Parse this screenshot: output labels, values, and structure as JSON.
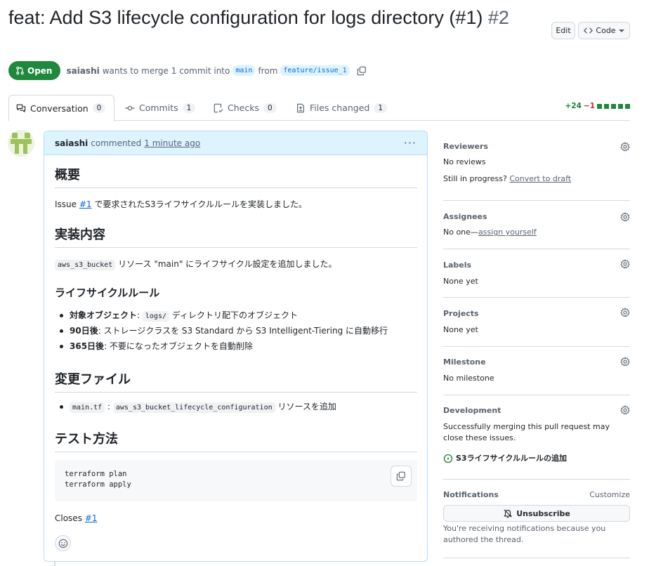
{
  "pr": {
    "title": "feat: Add S3 lifecycle configuration for logs directory (#1)",
    "number": "#2",
    "edit_label": "Edit",
    "code_label": "Code",
    "state": "Open",
    "author": "saiashi",
    "merge_text": "wants to merge 1 commit into",
    "base_branch": "main",
    "from_text": "from",
    "head_branch": "feature/issue_1"
  },
  "tabs": [
    {
      "label": "Conversation",
      "count": "0"
    },
    {
      "label": "Commits",
      "count": "1"
    },
    {
      "label": "Checks",
      "count": "0"
    },
    {
      "label": "Files changed",
      "count": "1"
    }
  ],
  "diffstat": {
    "additions": "+24",
    "deletions": "−1"
  },
  "comment": {
    "author": "saiashi",
    "action": "commented",
    "time": "1 minute ago",
    "more": "···",
    "h_overview": "概要",
    "overview_pre": "Issue",
    "overview_link": "#1",
    "overview_post": "で要求されたS3ライフサイクルルールを実装しました。",
    "h_impl": "実装内容",
    "impl_code": "aws_s3_bucket",
    "impl_text": "リソース \"main\" にライフサイクル設定を追加しました。",
    "h_rules": "ライフサイクルルール",
    "rule1_label": "対象オブジェクト",
    "rule1_colon": ":",
    "rule1_code": "logs/",
    "rule1_text": "ディレクトリ配下のオブジェクト",
    "rule2_label": "90日後",
    "rule2_text": ": ストレージクラスを S3 Standard から S3 Intelligent-Tiering に自動移行",
    "rule3_label": "365日後",
    "rule3_text": ": 不要になったオブジェクトを自動削除",
    "h_files": "変更ファイル",
    "file_code1": "main.tf",
    "file_colon": ":",
    "file_code2": "aws_s3_bucket_lifecycle_configuration",
    "file_text": "リソースを追加",
    "h_test": "テスト方法",
    "code_line1": "terraform plan",
    "code_line2": "terraform apply",
    "closes_text": "Closes",
    "closes_link": "#1"
  },
  "sidebar": {
    "reviewers_title": "Reviewers",
    "reviewers_value": "No reviews",
    "draft_prefix": "Still in progress?",
    "draft_link": "Convert to draft",
    "assignees_title": "Assignees",
    "assignees_prefix": "No one—",
    "assignees_link": "assign yourself",
    "labels_title": "Labels",
    "labels_value": "None yet",
    "projects_title": "Projects",
    "projects_value": "None yet",
    "milestone_title": "Milestone",
    "milestone_value": "No milestone",
    "development_title": "Development",
    "development_text": "Successfully merging this pull request may close these issues.",
    "development_issue": "S3ライフサイクルルールの追加",
    "notifications_title": "Notifications",
    "customize_label": "Customize",
    "unsubscribe_label": "Unsubscribe",
    "notifications_reason": "You're receiving notifications because you authored the thread."
  },
  "colors": {
    "open_green": "#1f883d",
    "link_blue": "#0969da",
    "header_blue": "#ddf4ff"
  }
}
